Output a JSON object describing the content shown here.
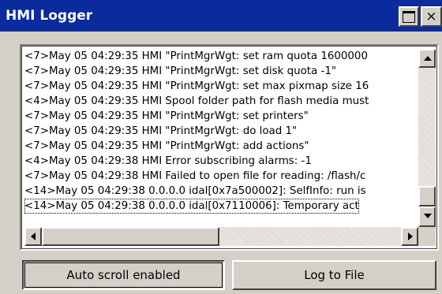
{
  "window": {
    "title": "HMI Logger"
  },
  "titlebar": {
    "maximize_icon": "maximize-icon",
    "close_icon": "close-icon",
    "close_glyph": "×"
  },
  "log": {
    "lines": [
      "<7>May 05 04:29:35 HMI \"PrintMgrWgt: set ram quota 1600000",
      "<7>May 05 04:29:35 HMI \"PrintMgrWgt: set disk quota -1\"",
      "<7>May 05 04:29:35 HMI \"PrintMgrWgt: set max pixmap size 16",
      "<4>May 05 04:29:35 HMI Spool folder path for flash media must",
      "<7>May 05 04:29:35 HMI \"PrintMgrWgt: set printers\"",
      "<7>May 05 04:29:35 HMI \"PrintMgrWgt: do load 1\"",
      "<7>May 05 04:29:35 HMI \"PrintMgrWgt: add actions\"",
      "<4>May 05 04:29:38 HMI Error subscribing alarms: -1",
      "<7>May 05 04:29:38 HMI Failed to open file for reading: /flash/c",
      "<14>May 05 04:29:38 0.0.0.0  idal[0x7a500002]: SelfInfo: run is",
      "<14>May 05 04:29:38 0.0.0.0  idal[0x7110006]: Temporary act"
    ],
    "focused_index": 10
  },
  "buttons": {
    "auto_scroll": "Auto scroll enabled",
    "log_to_file": "Log to File"
  }
}
